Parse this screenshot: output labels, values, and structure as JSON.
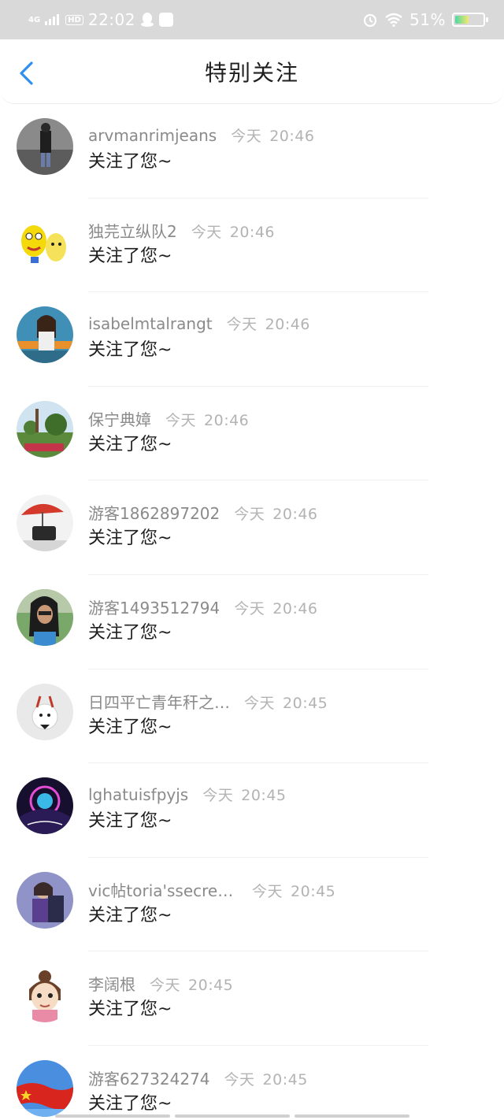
{
  "status_bar": {
    "network": "4G",
    "hd": "HD",
    "time": "22:02",
    "battery_percent": "51%",
    "battery_level": 0.51
  },
  "header": {
    "back_icon": "chevron-left-icon",
    "title": "特别关注"
  },
  "notifications": [
    {
      "name": "arvmanrimjeans",
      "day": "今天",
      "time": "20:46",
      "action": "关注了您~"
    },
    {
      "name": "独芫立纵队2",
      "day": "今天",
      "time": "20:46",
      "action": "关注了您~"
    },
    {
      "name": "isabelmtalrangt",
      "day": "今天",
      "time": "20:46",
      "action": "关注了您~"
    },
    {
      "name": "保宁典嫜",
      "day": "今天",
      "time": "20:46",
      "action": "关注了您~"
    },
    {
      "name": "游客1862897202",
      "day": "今天",
      "time": "20:46",
      "action": "关注了您~"
    },
    {
      "name": "游客1493512794",
      "day": "今天",
      "time": "20:46",
      "action": "关注了您~"
    },
    {
      "name": "日四平亡青年秆之…",
      "day": "今天",
      "time": "20:45",
      "action": "关注了您~"
    },
    {
      "name": "lghatuisfpyjs",
      "day": "今天",
      "time": "20:45",
      "action": "关注了您~"
    },
    {
      "name": "vic帖toria'ssecre繁t",
      "day": "今天",
      "time": "20:45",
      "action": "关注了您~"
    },
    {
      "name": "李阔根",
      "day": "今天",
      "time": "20:45",
      "action": "关注了您~"
    },
    {
      "name": "游客627324274",
      "day": "今天",
      "time": "20:45",
      "action": "关注了您~"
    }
  ],
  "colors": {
    "accent": "#2f8ff0",
    "status_bar_bg": "#d9d9d9",
    "name_text": "#8a8a8a",
    "time_text": "#b3b3b3"
  }
}
